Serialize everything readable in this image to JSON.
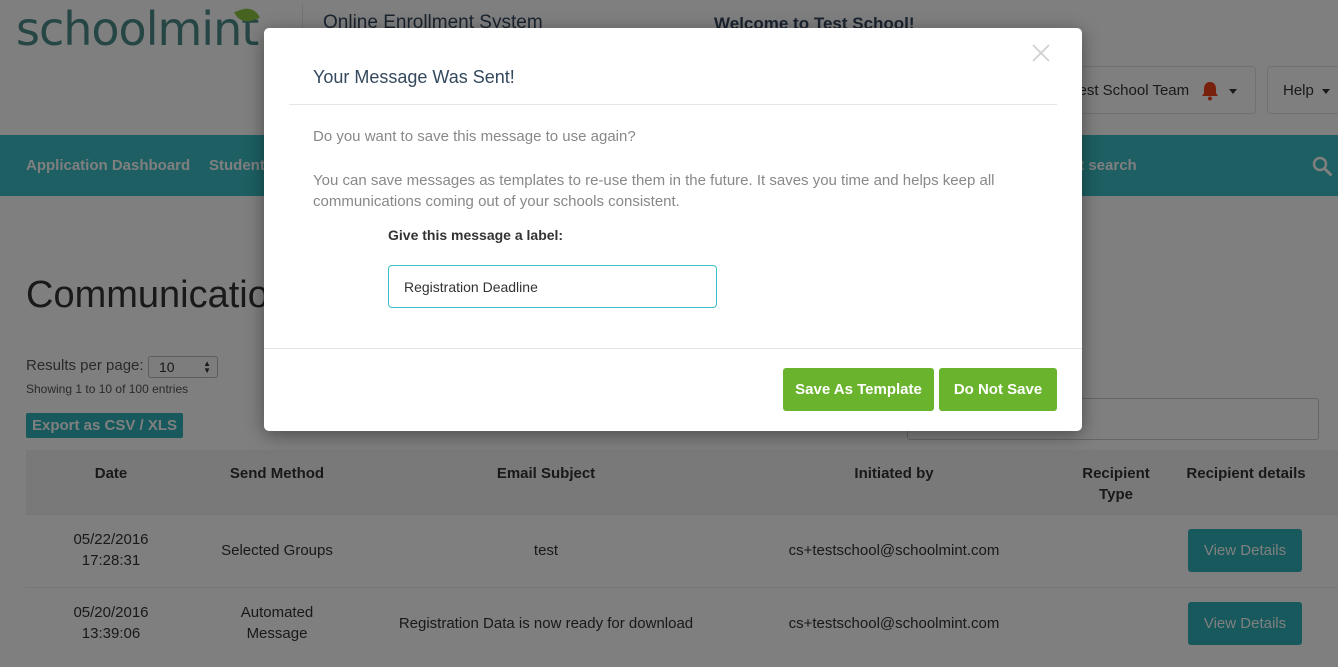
{
  "header": {
    "logo_text": "schoolmint",
    "system_name": "Online Enrollment System",
    "welcome": "Welcome to Test School!",
    "team_label": "Test School Team",
    "help_label": "Help"
  },
  "nav": {
    "items": [
      "Application Dashboard",
      "Students",
      "nt search"
    ]
  },
  "page": {
    "title": "Communications",
    "results_per_page_label": "Results per page:",
    "results_per_page_value": "10",
    "showing": "Showing 1 to 10 of 100 entries",
    "export_label": "Export as CSV / XLS"
  },
  "table": {
    "headers": [
      "Date",
      "Send Method",
      "Email Subject",
      "Initiated by",
      "Recipient Type",
      "Recipient details"
    ],
    "rows": [
      {
        "date": "05/22/2016",
        "time": "17:28:31",
        "method": "Selected Groups",
        "subject": "test",
        "initiated_by": "cs+testschool@schoolmint.com",
        "button": "View Details"
      },
      {
        "date": "05/20/2016",
        "time": "13:39:06",
        "method": "Automated Message",
        "subject": "Registration Data is now ready for download",
        "initiated_by": "cs+testschool@schoolmint.com",
        "button": "View Details"
      }
    ]
  },
  "modal": {
    "title": "Your Message Was Sent!",
    "question": "Do you want to save this message to use again?",
    "description": "You can save messages as templates to re-use them in the future. It saves you time and helps keep all communications coming out of your schools consistent.",
    "label_caption": "Give this message a label:",
    "label_value": "Registration Deadline",
    "save_button": "Save As Template",
    "dont_save_button": "Do Not Save"
  },
  "colors": {
    "nav_teal": "#3bbfc4",
    "button_green": "#6ab42d",
    "bell_red": "#f0441c"
  },
  "icons": [
    "bell-icon",
    "search-icon",
    "close-icon",
    "caret-down-icon"
  ]
}
